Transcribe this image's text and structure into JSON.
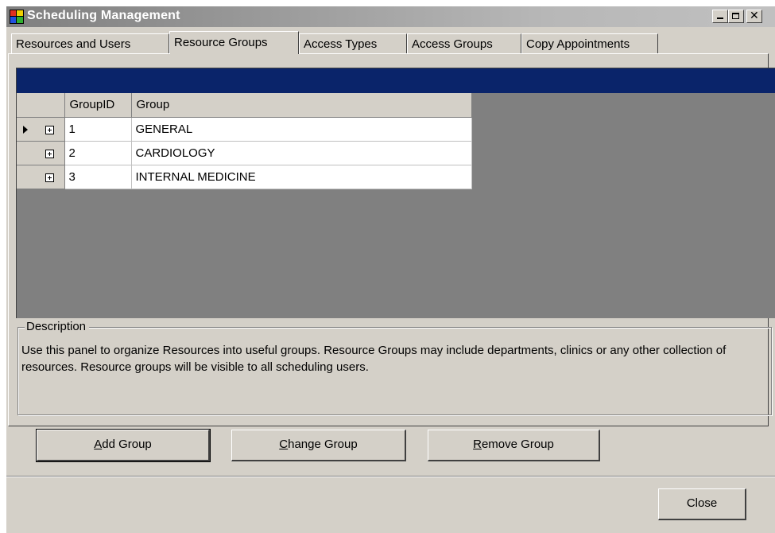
{
  "window": {
    "title": "Scheduling Management",
    "controls": {
      "minimize": "minimize-icon",
      "maximize": "maximize-icon",
      "close": "close-icon"
    }
  },
  "tabs": [
    {
      "label": "Resources and Users",
      "active": false
    },
    {
      "label": "Resource Groups",
      "active": true
    },
    {
      "label": "Access Types",
      "active": false
    },
    {
      "label": "Access Groups",
      "active": false
    },
    {
      "label": "Copy Appointments",
      "active": false
    }
  ],
  "grid": {
    "columns": [
      "GroupID",
      "Group"
    ],
    "rows": [
      {
        "id": "1",
        "group": "GENERAL",
        "current": true
      },
      {
        "id": "2",
        "group": "CARDIOLOGY",
        "current": false
      },
      {
        "id": "3",
        "group": "INTERNAL MEDICINE",
        "current": false
      }
    ]
  },
  "description": {
    "legend": "Description",
    "text": "Use this panel to organize Resources into useful groups.  Resource Groups may include departments, clinics or any other collection of resources.  Resource groups will be visible to all scheduling users."
  },
  "buttons": {
    "add": {
      "mnemonic": "A",
      "rest": "dd Group"
    },
    "change": {
      "mnemonic": "C",
      "rest": "hange Group"
    },
    "remove": {
      "mnemonic": "R",
      "rest": "emove Group"
    },
    "close": "Close"
  },
  "colors": {
    "caption_bar": "#0a246a",
    "face": "#d4d0c8",
    "grid_background": "#808080"
  }
}
